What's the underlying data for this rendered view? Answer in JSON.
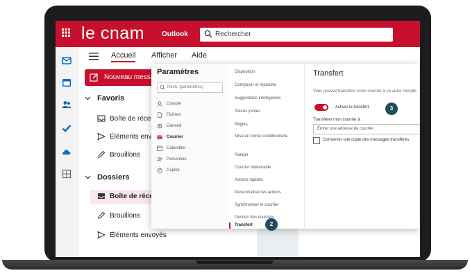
{
  "header": {
    "logo": "le cnam",
    "app_name": "Outlook",
    "search_placeholder": "Rechercher"
  },
  "ribbon": {
    "tabs": [
      {
        "label": "Accueil",
        "active": true
      },
      {
        "label": "Afficher",
        "active": false
      },
      {
        "label": "Aide",
        "active": false
      }
    ]
  },
  "new_mail_label": "Nouveau message",
  "folders": {
    "favorites_header": "Favoris",
    "favorites": [
      {
        "label": "Boîte de réception",
        "icon": "inbox-icon"
      },
      {
        "label": "Éléments envoyés",
        "icon": "send-icon"
      },
      {
        "label": "Brouillons",
        "icon": "draft-icon"
      }
    ],
    "folders_header": "Dossiers",
    "items": [
      {
        "label": "Boîte de réception",
        "icon": "inbox-icon",
        "selected": true
      },
      {
        "label": "Brouillons",
        "icon": "draft-icon",
        "selected": false
      },
      {
        "label": "Éléments envoyés",
        "icon": "send-icon",
        "selected": false
      }
    ]
  },
  "settings": {
    "title": "Paramètres",
    "search_placeholder": "Rech. (paramètres)",
    "nav": [
      {
        "label": "Compte",
        "icon": "account-icon",
        "active": false
      },
      {
        "label": "Fichiers",
        "icon": "file-icon",
        "active": false
      },
      {
        "label": "Général",
        "icon": "gear-icon",
        "active": false
      },
      {
        "label": "Courrier",
        "icon": "mail-icon",
        "active": true
      },
      {
        "label": "Calendrier",
        "icon": "calendar-icon",
        "active": false
      },
      {
        "label": "Personnes",
        "icon": "people-icon",
        "active": false
      },
      {
        "label": "Copilot",
        "icon": "copilot-icon",
        "active": false
      }
    ],
    "sub": [
      {
        "label": "Disposition",
        "active": false
      },
      {
        "label": "Composer et répondre",
        "active": false
      },
      {
        "label": "Suggestions intelligentes",
        "active": false
      },
      {
        "label": "Pièces jointes",
        "active": false
      },
      {
        "label": "Règles",
        "active": false
      },
      {
        "label": "Mise en forme conditionnelle",
        "active": false
      },
      {
        "label": "Ranger",
        "active": false
      },
      {
        "label": "Courrier indésirable",
        "active": false
      },
      {
        "label": "Actions rapides",
        "active": false
      },
      {
        "label": "Personnaliser les actions",
        "active": false
      },
      {
        "label": "Synchroniser le courrier",
        "active": false
      },
      {
        "label": "Gestion des courriers",
        "active": false
      },
      {
        "label": "Transfert",
        "active": true
      }
    ],
    "content": {
      "title": "Transfert",
      "description": "Vous pouvez transférer votre courrier à un autre compte.",
      "toggle_label": "Activer le transfert",
      "forward_to_label": "Transférer mon courrier à :",
      "forward_to_placeholder": "Entrer une adresse de courrier",
      "keep_copy_label": "Conserver une copie des messages transférés"
    }
  },
  "badges": {
    "step2": "2",
    "step3": "3"
  },
  "colors": {
    "brand": "#c8102e",
    "badge": "#1f4e5a"
  }
}
